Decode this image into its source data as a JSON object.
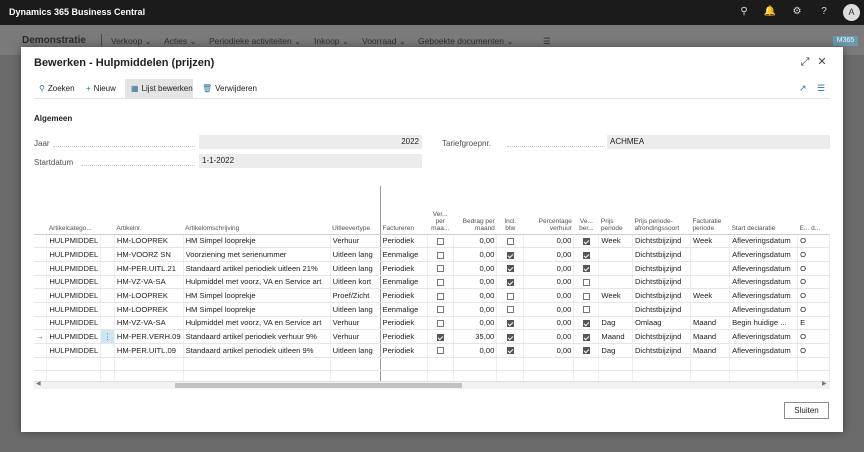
{
  "app": {
    "title": "Dynamics 365 Business Central",
    "avatar": "A",
    "icons": [
      "search-icon",
      "bell-icon",
      "gear-icon",
      "help-icon"
    ]
  },
  "nav": {
    "company": "Demonstratie",
    "menus": [
      "Verkoop",
      "Acties",
      "Periodieke activiteiten",
      "Inkoop",
      "Voorraad",
      "Geboekte documenten"
    ],
    "badge": "M365"
  },
  "modal": {
    "title": "Bewerken - Hulpmiddelen (prijzen)",
    "actions": {
      "search": "Zoeken",
      "new": "Nieuw",
      "edit_list": "Lijst bewerken",
      "delete": "Verwijderen"
    },
    "section": "Algemeen",
    "fields": {
      "jaar_label": "Jaar",
      "jaar_value": "2022",
      "start_label": "Startdatum",
      "start_value": "1-1-2022",
      "tarief_label": "Tariefgroepnr.",
      "tarief_value": "ACHMEA"
    },
    "close_label": "Sluiten"
  },
  "table": {
    "columns": [
      "Artikelcatego...",
      "Artikelnr.",
      "Artikelomschrijving",
      "Uitleevertype",
      "Factureren",
      "Ver... per maa...",
      "Bedrag per maand",
      "Incl. btw",
      "Percentage verhuur",
      "Ve... ber...",
      "Prijs periode",
      "Prijs periode-afrondingssoort",
      "Facturatie periode",
      "Start declaratie",
      "E... d..."
    ],
    "rows": [
      {
        "cat": "HULPMIDDEL",
        "nr": "HM-LOOPREK",
        "desc": "HM Simpel looprekje",
        "type": "Verhuur",
        "fact": "Periodiek",
        "vpm": false,
        "amount": "0,00",
        "btw": false,
        "pct": "0,00",
        "vb": true,
        "pp": "Week",
        "pa": "Dichtstbijzijnd",
        "fp": "Week",
        "sd": "Afleveringsdatum",
        "ed": "O",
        "arrow": false,
        "dots": false
      },
      {
        "cat": "HULPMIDDEL",
        "nr": "HM-VOORZ SN",
        "desc": "Voorziening met serienummer",
        "type": "Uitleen lang",
        "fact": "Eenmalige",
        "vpm": false,
        "amount": "0,00",
        "btw": true,
        "pct": "0,00",
        "vb": true,
        "pp": "",
        "pa": "Dichtstbijzijnd",
        "fp": "",
        "sd": "Afleveringsdatum",
        "ed": "O",
        "arrow": false,
        "dots": false
      },
      {
        "cat": "HULPMIDDEL",
        "nr": "HM-PER.UITL.21",
        "desc": "Standaard artikel periodiek uitleen 21%",
        "type": "Uitleen lang",
        "fact": "Periodiek",
        "vpm": false,
        "amount": "0,00",
        "btw": true,
        "pct": "0,00",
        "vb": true,
        "pp": "",
        "pa": "Dichtstbijzijnd",
        "fp": "",
        "sd": "Afleveringsdatum",
        "ed": "O",
        "arrow": false,
        "dots": false
      },
      {
        "cat": "HULPMIDDEL",
        "nr": "HM-VZ-VA-SA",
        "desc": "Hulpmiddel met voorz, VA en Service art",
        "type": "Uitleen kort",
        "fact": "Eenmalige",
        "vpm": false,
        "amount": "0,00",
        "btw": true,
        "pct": "0,00",
        "vb": false,
        "pp": "",
        "pa": "Dichtstbijzijnd",
        "fp": "",
        "sd": "Afleveringsdatum",
        "ed": "O",
        "arrow": false,
        "dots": false
      },
      {
        "cat": "HULPMIDDEL",
        "nr": "HM-LOOPREK",
        "desc": "HM Simpel looprekje",
        "type": "Proef/Zicht",
        "fact": "Periodiek",
        "vpm": false,
        "amount": "0,00",
        "btw": false,
        "pct": "0,00",
        "vb": false,
        "pp": "Week",
        "pa": "Dichtstbijzijnd",
        "fp": "Week",
        "sd": "Afleveringsdatum",
        "ed": "O",
        "arrow": false,
        "dots": false
      },
      {
        "cat": "HULPMIDDEL",
        "nr": "HM-LOOPREK",
        "desc": "HM Simpel looprekje",
        "type": "Uitleen lang",
        "fact": "Eenmalige",
        "vpm": false,
        "amount": "0,00",
        "btw": false,
        "pct": "0,00",
        "vb": false,
        "pp": "",
        "pa": "Dichtstbijzijnd",
        "fp": "",
        "sd": "Afleveringsdatum",
        "ed": "O",
        "arrow": false,
        "dots": false
      },
      {
        "cat": "HULPMIDDEL",
        "nr": "HM-VZ-VA-SA",
        "desc": "Hulpmiddel met voorz, VA en Service art",
        "type": "Verhuur",
        "fact": "Periodiek",
        "vpm": false,
        "amount": "0,00",
        "btw": true,
        "pct": "0,00",
        "vb": true,
        "pp": "Dag",
        "pa": "Omlaag",
        "fp": "Maand",
        "sd": "Begin huidige ...",
        "ed": "E",
        "arrow": false,
        "dots": false
      },
      {
        "cat": "HULPMIDDEL",
        "nr": "HM-PER.VERH.09",
        "desc": "Standaard artikel periodiek verhuur 9%",
        "type": "Verhuur",
        "fact": "Periodiek",
        "vpm": true,
        "amount": "35,00",
        "btw": true,
        "pct": "0,00",
        "vb": true,
        "pp": "Maand",
        "pa": "Dichtstbijzijnd",
        "fp": "Maand",
        "sd": "Afleveringsdatum",
        "ed": "O",
        "arrow": true,
        "dots": true
      },
      {
        "cat": "HULPMIDDEL",
        "nr": "HM-PER.UITL.09",
        "desc": "Standaard artikel periodiek uitleen 9%",
        "type": "Uitleen lang",
        "fact": "Periodiek",
        "vpm": false,
        "amount": "0,00",
        "btw": true,
        "pct": "0,00",
        "vb": true,
        "pp": "Dag",
        "pa": "Dichtstbijzijnd",
        "fp": "Maand",
        "sd": "Afleveringsdatum",
        "ed": "O",
        "arrow": false,
        "dots": false
      }
    ]
  }
}
